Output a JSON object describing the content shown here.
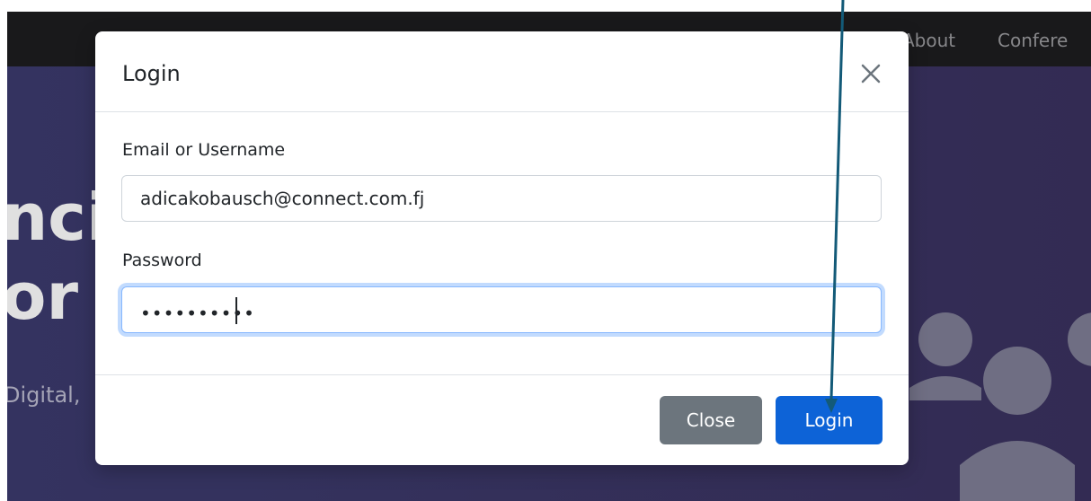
{
  "nav": {
    "links": [
      "About",
      "Confere"
    ]
  },
  "hero": {
    "title_line1": "nci",
    "title_line2": "or",
    "subtitle": "Digital,"
  },
  "modal": {
    "title": "Login",
    "close_icon": "close-icon",
    "fields": {
      "username_label": "Email or Username",
      "username_value": "adicakobausch@connect.com.fj",
      "password_label": "Password",
      "password_mask": "••••••••••"
    },
    "buttons": {
      "close_label": "Close",
      "login_label": "Login"
    }
  },
  "colors": {
    "topbar": "#1d1d1f",
    "hero": "#3c3b6e",
    "primary": "#0d63d7",
    "secondary": "#6c757d",
    "annotation_arrow": "#135a78"
  }
}
